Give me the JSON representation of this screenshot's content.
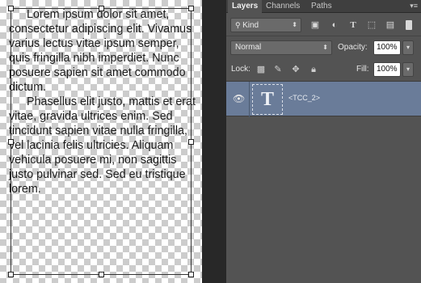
{
  "canvas": {
    "paragraphs": [
      "Lorem ipsum dolor sit amet, consectetur adipiscing elit. Vivamus varius lectus vitae ipsum semper, quis fringilla nibh imperdiet. Nunc posuere sapien sit amet commodo dictum.",
      "Phasellus elit justo, mattis et erat vitae, gravida ultrices enim. Sed tincidunt sapien vitae nulla fringilla, vel lacinia felis ultricies. Aliquam vehicula posuere mi, non sagittis justo pulvinar sed. Sed eu tristique lorem."
    ]
  },
  "panel": {
    "tabs": [
      "Layers",
      "Channels",
      "Paths"
    ],
    "active_tab": "Layers",
    "filter": {
      "label": "Kind",
      "icons": [
        "image-filter-icon",
        "adjustment-filter-icon",
        "type-filter-icon",
        "shape-filter-icon",
        "smart-object-filter-icon"
      ]
    },
    "blend_mode": "Normal",
    "opacity_label": "Opacity:",
    "opacity_value": "100%",
    "lock_label": "Lock:",
    "fill_label": "Fill:",
    "fill_value": "100%",
    "layers": [
      {
        "name": "<TCC_2>",
        "type": "text",
        "thumb_glyph": "T",
        "visible": true,
        "selected": true
      }
    ]
  },
  "colors": {
    "panel_bg": "#535353",
    "selected_layer": "#6a7c99",
    "canvas_checker": "#cccccc"
  }
}
